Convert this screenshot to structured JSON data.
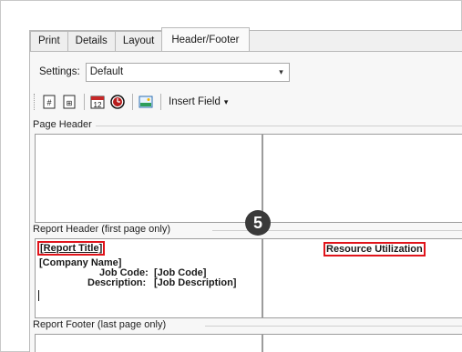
{
  "tabs": [
    {
      "label": "Print",
      "active": false
    },
    {
      "label": "Details",
      "active": false
    },
    {
      "label": "Layout",
      "active": false
    },
    {
      "label": "Header/Footer",
      "active": true
    }
  ],
  "settings": {
    "label": "Settings:",
    "value": "Default"
  },
  "toolbar": {
    "icons": [
      "page-number-icon",
      "page-count-icon",
      "date-icon",
      "time-icon",
      "image-icon"
    ],
    "insert_field_label": "Insert Field"
  },
  "sections": {
    "page_header": "Page Header",
    "report_header": "Report Header (first page only)",
    "report_footer": "Report Footer (last page only)"
  },
  "report_header": {
    "left": {
      "title": "[Report Title]",
      "company": "[Company Name]",
      "job_code_label": "Job Code:",
      "job_code_value": "[Job Code]",
      "description_label": "Description:",
      "description_value": "[Job Description]"
    },
    "center": {
      "title": "Resource Utilization"
    }
  },
  "step_badge": "5",
  "colors": {
    "highlight": "#e0141b",
    "badge": "#3a3a3a"
  }
}
